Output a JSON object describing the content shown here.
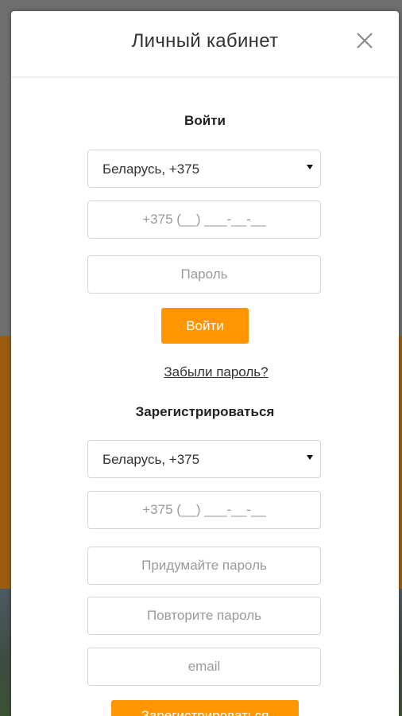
{
  "modal": {
    "title": "Личный кабинет",
    "close_icon": "close-icon"
  },
  "login": {
    "heading": "Войти",
    "country_select": "Беларусь, +375",
    "phone_placeholder": "+375 (__) ___-__-__",
    "password_placeholder": "Пароль",
    "submit_label": "Войти",
    "forgot_link": "Забыли пароль?"
  },
  "register": {
    "heading": "Зарегистрироваться",
    "country_select": "Беларусь, +375",
    "phone_placeholder": "+375 (__) ___-__-__",
    "password_placeholder": "Придумайте пароль",
    "password_repeat_placeholder": "Повторите пароль",
    "email_placeholder": "email",
    "submit_label": "Зарегистрироваться"
  },
  "colors": {
    "accent": "#ff9500",
    "overlay_top": "#6e6e6e",
    "overlay_band": "#9a5d10"
  }
}
